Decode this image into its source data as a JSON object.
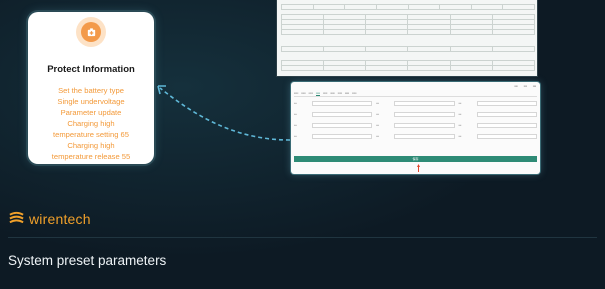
{
  "protect_card": {
    "title": "Protect Information",
    "items": [
      "Set the battery type",
      "Single undervoltage",
      "Parameter update",
      "Charging high",
      "temperature setting 65",
      "Charging high",
      "temperature release 55"
    ],
    "icon": "battery-shield-icon",
    "accent": "#f39a3a"
  },
  "bottom_screenshot": {
    "save_label": "保存",
    "tab_active": "Parameters"
  },
  "brand": {
    "name": "wirentech",
    "color": "#f0a02a"
  },
  "caption": "System preset parameters"
}
